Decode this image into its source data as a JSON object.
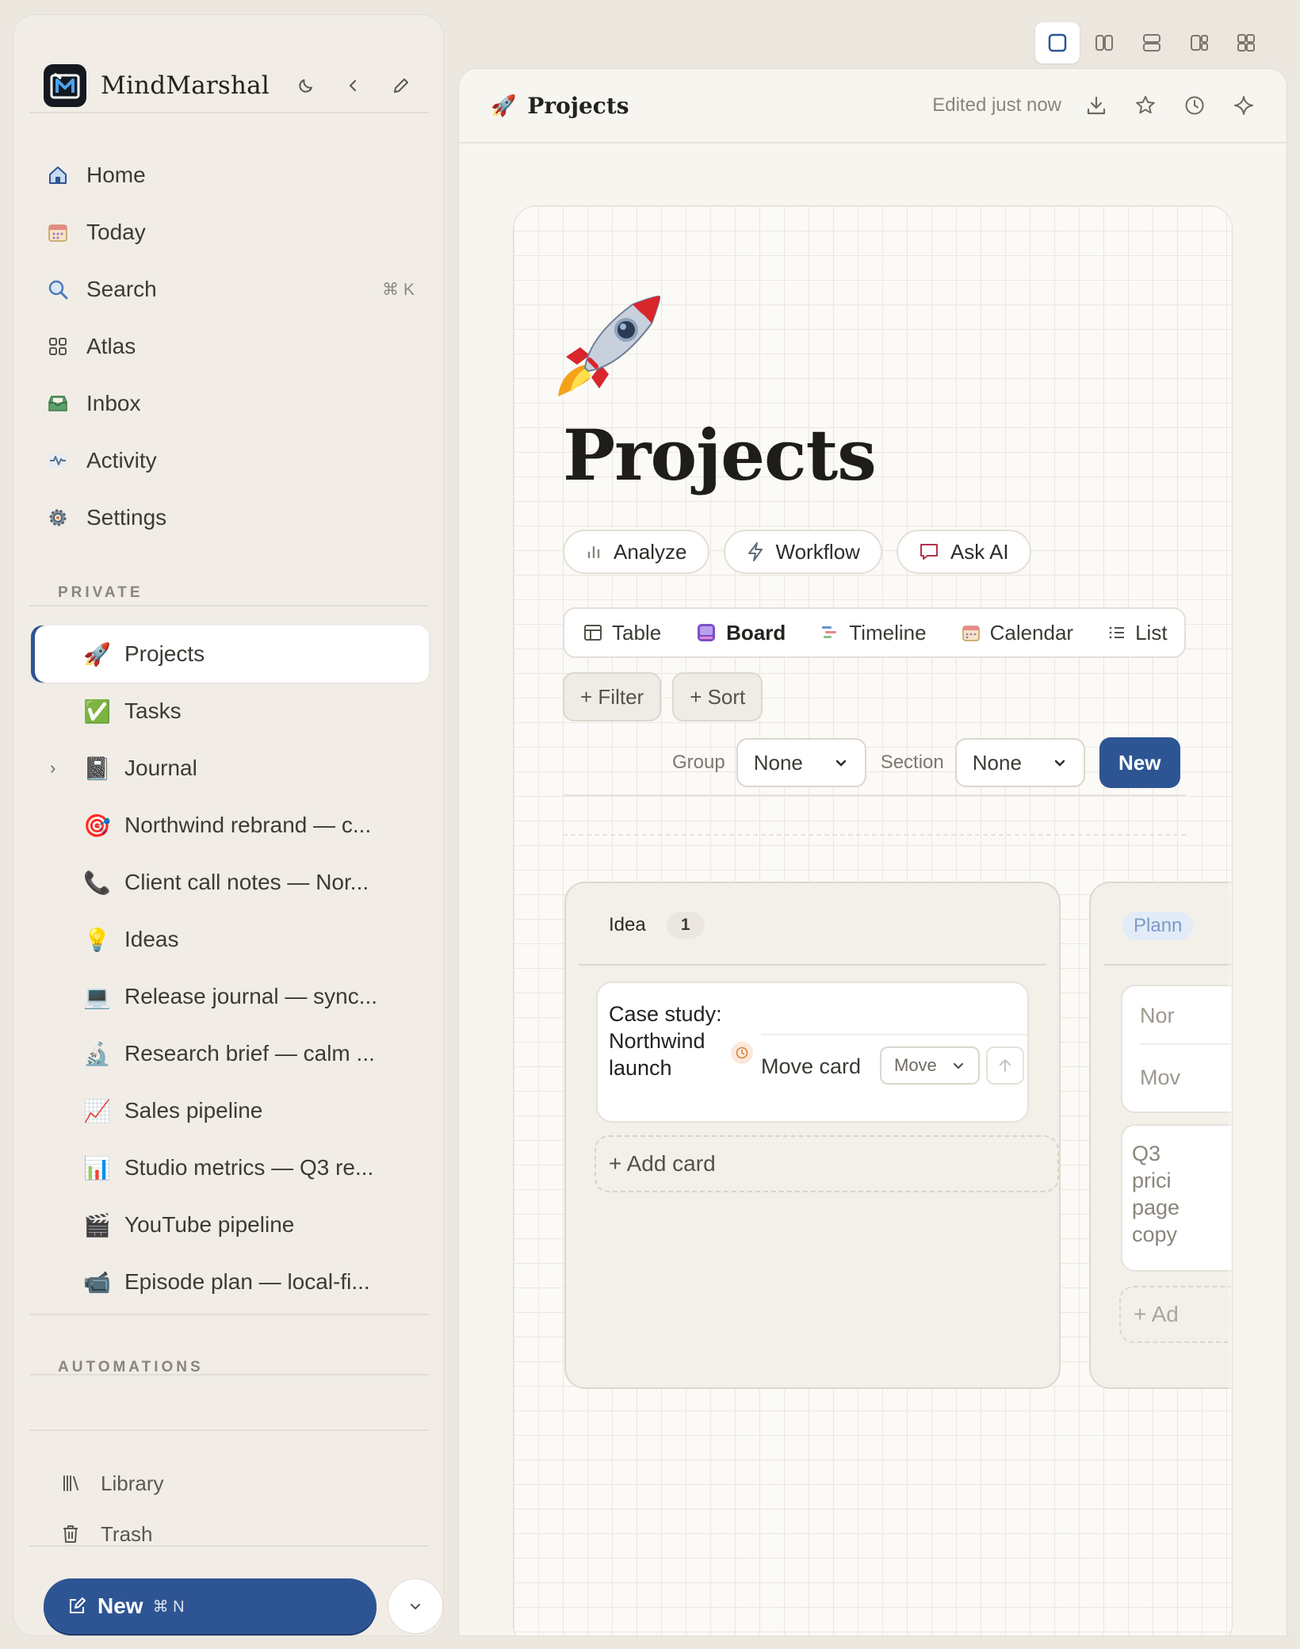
{
  "app": {
    "name": "MindMarshal"
  },
  "nav": [
    {
      "label": "Home",
      "icon": "home-icon"
    },
    {
      "label": "Today",
      "icon": "calendar-icon"
    },
    {
      "label": "Search",
      "icon": "search-icon",
      "shortcut": "⌘ K"
    },
    {
      "label": "Atlas",
      "icon": "grid-icon"
    },
    {
      "label": "Inbox",
      "icon": "inbox-icon"
    },
    {
      "label": "Activity",
      "icon": "activity-icon"
    },
    {
      "label": "Settings",
      "icon": "gear-icon"
    }
  ],
  "sections": {
    "private": "PRIVATE",
    "automations": "AUTOMATIONS"
  },
  "pages": [
    {
      "label": "Projects",
      "emoji": "🚀",
      "active": true
    },
    {
      "label": "Tasks",
      "emoji": "✅"
    },
    {
      "label": "Journal",
      "emoji": "📓",
      "expandable": true
    },
    {
      "label": "Northwind rebrand — c...",
      "emoji": "🎯"
    },
    {
      "label": "Client call notes — Nor...",
      "emoji": "📞"
    },
    {
      "label": "Ideas",
      "emoji": "💡"
    },
    {
      "label": "Release journal — sync...",
      "emoji": "💻"
    },
    {
      "label": "Research brief — calm ...",
      "emoji": "🔬"
    },
    {
      "label": "Sales pipeline",
      "emoji": "📈"
    },
    {
      "label": "Studio metrics — Q3 re...",
      "emoji": "📊"
    },
    {
      "label": "YouTube pipeline",
      "emoji": "🎬"
    },
    {
      "label": "Episode plan — local-fi...",
      "emoji": "📹"
    }
  ],
  "footer": {
    "library": "Library",
    "trash": "Trash",
    "new_label": "New",
    "new_shortcut": "⌘ N"
  },
  "topbar": {
    "title": "Projects",
    "emoji": "🚀",
    "edited": "Edited just now"
  },
  "page": {
    "title": "Projects",
    "emoji": "🚀"
  },
  "actions": {
    "analyze": "Analyze",
    "workflow": "Workflow",
    "ask_ai": "Ask AI"
  },
  "views": [
    {
      "label": "Table",
      "icon": "table-icon"
    },
    {
      "label": "Board",
      "icon": "board-icon",
      "active": true
    },
    {
      "label": "Timeline",
      "icon": "timeline-icon"
    },
    {
      "label": "Calendar",
      "icon": "calendar-icon"
    },
    {
      "label": "List",
      "icon": "list-icon"
    }
  ],
  "toolbar": {
    "filter": "+ Filter",
    "sort": "+ Sort",
    "group_label": "Group",
    "group_value": "None",
    "section_label": "Section",
    "section_value": "None",
    "new": "New"
  },
  "board": {
    "columns": [
      {
        "name": "Idea",
        "count": "1",
        "cards": [
          {
            "title": "Case study: Northwind launch",
            "move_label": "Move card",
            "move_select": "Move"
          }
        ],
        "add_card": "+ Add card"
      },
      {
        "name": "Plann",
        "cards": [
          {
            "line1": "Nor",
            "line2": "Mov"
          },
          {
            "title": "Q3 prici page copy"
          }
        ],
        "add_card": "+ Ad"
      }
    ]
  },
  "colors": {
    "accent": "#2e5593",
    "sidebar_bg": "#f1ede6",
    "canvas_bg": "#fbfaf7"
  }
}
